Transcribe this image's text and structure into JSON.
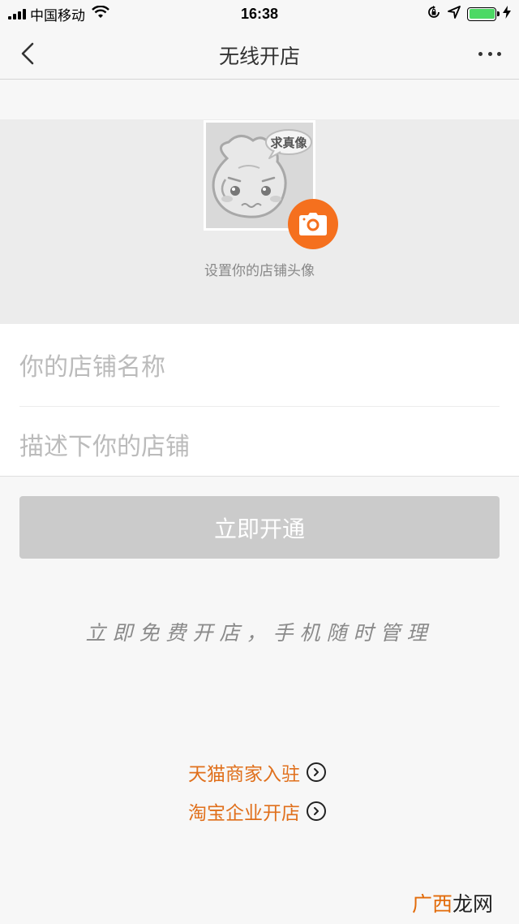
{
  "status_bar": {
    "carrier": "中国移动",
    "time": "16:38",
    "battery_level": 1.0,
    "icons": [
      "signal-icon",
      "wifi-icon",
      "rotation-lock-icon",
      "location-icon",
      "battery-icon",
      "charging-icon"
    ]
  },
  "nav": {
    "title": "无线开店",
    "back_icon": "chevron-left-icon",
    "more_icon": "more-dots-icon"
  },
  "avatar": {
    "badge_text": "求真像",
    "caption": "设置你的店铺头像",
    "camera_icon": "camera-icon",
    "camera_color": "#f5701e"
  },
  "form": {
    "name_placeholder": "你的店铺名称",
    "name_value": "",
    "desc_placeholder": "描述下你的店铺",
    "desc_value": ""
  },
  "submit": {
    "label": "立即开通",
    "color": "#cbcbcb"
  },
  "slogan": "立即免费开店，手机随时管理",
  "links": {
    "tmall": "天猫商家入驻",
    "taobao": "淘宝企业开店",
    "color": "#e0701c"
  },
  "watermark": {
    "part1": "广西",
    "part2": "龙网"
  }
}
